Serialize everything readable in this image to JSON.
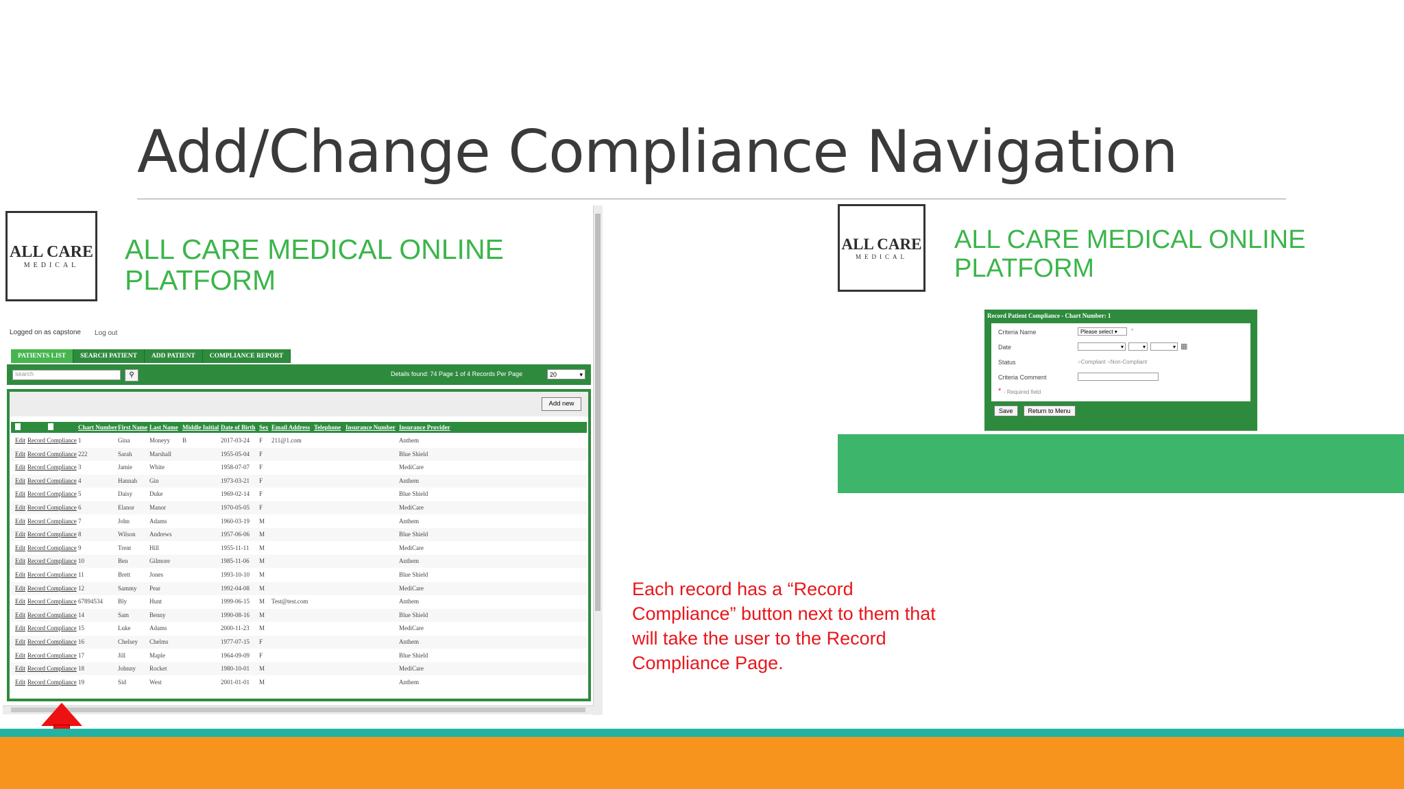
{
  "slide": {
    "title": "Add/Change Compliance Navigation",
    "annotation": "Each record has a “Record Compliance” button next to them that will take the user to the Record Compliance Page."
  },
  "logo": {
    "main": "ALL CARE",
    "sub": "MEDICAL"
  },
  "app": {
    "title_line1": "ALL CARE MEDICAL ONLINE",
    "title_line2": "PLATFORM"
  },
  "left": {
    "logged_in": "Logged on as capstone",
    "logout": "Log out",
    "tabs": [
      "PATIENTS LIST",
      "SEARCH PATIENT",
      "ADD PATIENT",
      "COMPLIANCE REPORT"
    ],
    "search_placeholder": "search",
    "details": "Details found: 74   Page 1 of 4   Records Per Page",
    "per_page": "20",
    "add_new": "Add new",
    "columns": [
      "Chart Number",
      "First Name",
      "Last Name",
      "Middle Initial",
      "Date of Birth",
      "Sex",
      "Email Address",
      "Telephone",
      "Insurance Number",
      "Insurance Provider"
    ],
    "edit_label": "Edit",
    "record_label": "Record Compliance",
    "rows": [
      {
        "chart": "1",
        "first": "Gina",
        "last": "Moneyy",
        "mi": "B",
        "dob": "2017-03-24",
        "sex": "F",
        "email": "211@1.com",
        "provider": "Anthem"
      },
      {
        "chart": "222",
        "first": "Sarah",
        "last": "Marshall",
        "mi": "",
        "dob": "1955-05-04",
        "sex": "F",
        "email": "",
        "provider": "Blue Shield"
      },
      {
        "chart": "3",
        "first": "Jamie",
        "last": "White",
        "mi": "",
        "dob": "1958-07-07",
        "sex": "F",
        "email": "",
        "provider": "MediCare"
      },
      {
        "chart": "4",
        "first": "Hannah",
        "last": "Gin",
        "mi": "",
        "dob": "1973-03-21",
        "sex": "F",
        "email": "",
        "provider": "Anthem"
      },
      {
        "chart": "5",
        "first": "Daisy",
        "last": "Duke",
        "mi": "",
        "dob": "1969-02-14",
        "sex": "F",
        "email": "",
        "provider": "Blue Shield"
      },
      {
        "chart": "6",
        "first": "Elanor",
        "last": "Manor",
        "mi": "",
        "dob": "1970-05-05",
        "sex": "F",
        "email": "",
        "provider": "MediCare"
      },
      {
        "chart": "7",
        "first": "John",
        "last": "Adams",
        "mi": "",
        "dob": "1960-03-19",
        "sex": "M",
        "email": "",
        "provider": "Anthem"
      },
      {
        "chart": "8",
        "first": "Wilson",
        "last": "Andrews",
        "mi": "",
        "dob": "1957-06-06",
        "sex": "M",
        "email": "",
        "provider": "Blue Shield"
      },
      {
        "chart": "9",
        "first": "Trent",
        "last": "Hill",
        "mi": "",
        "dob": "1955-11-11",
        "sex": "M",
        "email": "",
        "provider": "MediCare"
      },
      {
        "chart": "10",
        "first": "Ben",
        "last": "Gilmore",
        "mi": "",
        "dob": "1985-11-06",
        "sex": "M",
        "email": "",
        "provider": "Anthem"
      },
      {
        "chart": "11",
        "first": "Brett",
        "last": "Jones",
        "mi": "",
        "dob": "1993-10-10",
        "sex": "M",
        "email": "",
        "provider": "Blue Shield"
      },
      {
        "chart": "12",
        "first": "Sammy",
        "last": "Pear",
        "mi": "",
        "dob": "1992-04-08",
        "sex": "M",
        "email": "",
        "provider": "MediCare"
      },
      {
        "chart": "67894534",
        "first": "Bly",
        "last": "Hunt",
        "mi": "",
        "dob": "1999-06-15",
        "sex": "M",
        "email": "Test@test.com",
        "provider": "Anthem"
      },
      {
        "chart": "14",
        "first": "Sam",
        "last": "Benny",
        "mi": "",
        "dob": "1990-08-16",
        "sex": "M",
        "email": "",
        "provider": "Blue Shield"
      },
      {
        "chart": "15",
        "first": "Luke",
        "last": "Adams",
        "mi": "",
        "dob": "2000-11-23",
        "sex": "M",
        "email": "",
        "provider": "MediCare"
      },
      {
        "chart": "16",
        "first": "Chelsey",
        "last": "Chelms",
        "mi": "",
        "dob": "1977-07-15",
        "sex": "F",
        "email": "",
        "provider": "Anthem"
      },
      {
        "chart": "17",
        "first": "Jill",
        "last": "Maple",
        "mi": "",
        "dob": "1964-09-09",
        "sex": "F",
        "email": "",
        "provider": "Blue Shield"
      },
      {
        "chart": "18",
        "first": "Johnny",
        "last": "Rocket",
        "mi": "",
        "dob": "1980-10-01",
        "sex": "M",
        "email": "",
        "provider": "MediCare"
      },
      {
        "chart": "19",
        "first": "Sid",
        "last": "West",
        "mi": "",
        "dob": "2001-01-01",
        "sex": "M",
        "email": "",
        "provider": "Anthem"
      }
    ]
  },
  "right": {
    "dialog_title": "Record Patient Compliance - Chart Number:  1",
    "criteria_label": "Criteria Name",
    "criteria_value": "Please select ▾",
    "date_label": "Date",
    "status_label": "Status",
    "status_options": "○Compliant  ○Non-Compliant",
    "comment_label": "Criteria Comment",
    "required_note": "- Required field",
    "save": "Save",
    "return": "Return to Menu"
  },
  "colors": {
    "green": "#2e8b3e",
    "title_green": "#3bb54a",
    "annotation_red": "#e8161b",
    "orange": "#f7941d",
    "teal": "#23b3a3"
  }
}
